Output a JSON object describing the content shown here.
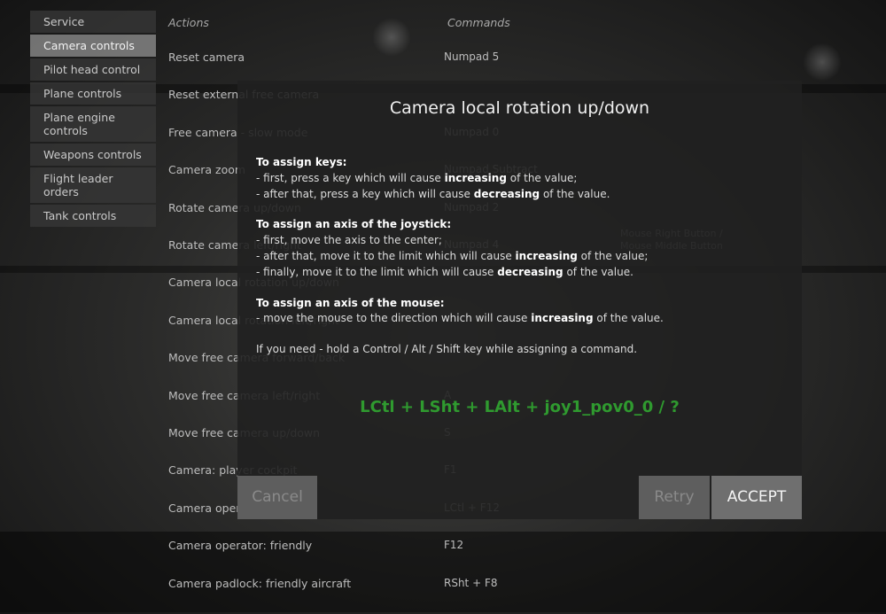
{
  "menu": {
    "items": [
      {
        "label": "Service"
      },
      {
        "label": "Camera controls"
      },
      {
        "label": "Pilot head control"
      },
      {
        "label": "Plane controls"
      },
      {
        "label": "Plane engine controls"
      },
      {
        "label": "Weapons controls"
      },
      {
        "label": "Flight leader orders"
      },
      {
        "label": "Tank controls"
      }
    ],
    "active_index": 1
  },
  "table": {
    "actions_header": "Actions",
    "commands_header": "Commands",
    "rows": [
      {
        "action": "Reset camera",
        "command": "Numpad 5",
        "command2": ""
      },
      {
        "action": "Reset external free camera",
        "command": "",
        "command2": ""
      },
      {
        "action": "Free camera - slow mode",
        "command": "Numpad 0",
        "command2": ""
      },
      {
        "action": "Camera zoom",
        "command": "Numpad Subtract",
        "command2": ""
      },
      {
        "action": "Rotate camera up/down",
        "command": "Numpad 2",
        "command2": ""
      },
      {
        "action": "Rotate camera left/right",
        "command": "Numpad 4",
        "command2": "Mouse Right Button / Mouse Middle Button"
      },
      {
        "action": "Camera local rotation up/down",
        "command": "",
        "command2": ""
      },
      {
        "action": "Camera local rotation left/right",
        "command": "",
        "command2": ""
      },
      {
        "action": "Move free camera forward/back",
        "command": "",
        "command2": ""
      },
      {
        "action": "Move free camera left/right",
        "command": "A",
        "command2": ""
      },
      {
        "action": "Move free camera up/down",
        "command": "S",
        "command2": ""
      },
      {
        "action": "Camera: player cockpit",
        "command": "F1",
        "command2": ""
      },
      {
        "action": "Camera operator",
        "command": "LCtl + F12",
        "command2": ""
      },
      {
        "action": "Camera operator: friendly",
        "command": "F12",
        "command2": ""
      },
      {
        "action": "Camera padlock: friendly aircraft",
        "command": "RSht + F8",
        "command2": ""
      }
    ]
  },
  "dialog": {
    "title": "Camera local rotation up/down",
    "keys_heading": "To assign keys:",
    "keys_line1": [
      "- first, press a key which will cause ",
      "increasing",
      " of the value;"
    ],
    "keys_line2": [
      "- after that, press a key which will cause ",
      "decreasing",
      " of the value."
    ],
    "joy_heading": "To assign an axis of the joystick:",
    "joy_line1": "- first, move the axis to the center;",
    "joy_line2": [
      "- after that, move it to the limit which will cause ",
      "increasing",
      " of the value;"
    ],
    "joy_line3": [
      "- finally, move it to the limit which will cause ",
      "decreasing",
      " of the value."
    ],
    "mouse_heading": "To assign an axis of the mouse:",
    "mouse_line1": [
      "- move the mouse to the direction which will cause ",
      "increasing",
      " of the value."
    ],
    "modifier_note": "If you need - hold a Control / Alt / Shift key while assigning a command.",
    "combo": "LCtl + LSht + LAlt + joy1_pov0_0 / ?",
    "combo_color": "#2f9a2f",
    "cancel_label": "Cancel",
    "retry_label": "Retry",
    "accept_label": "ACCEPT"
  }
}
